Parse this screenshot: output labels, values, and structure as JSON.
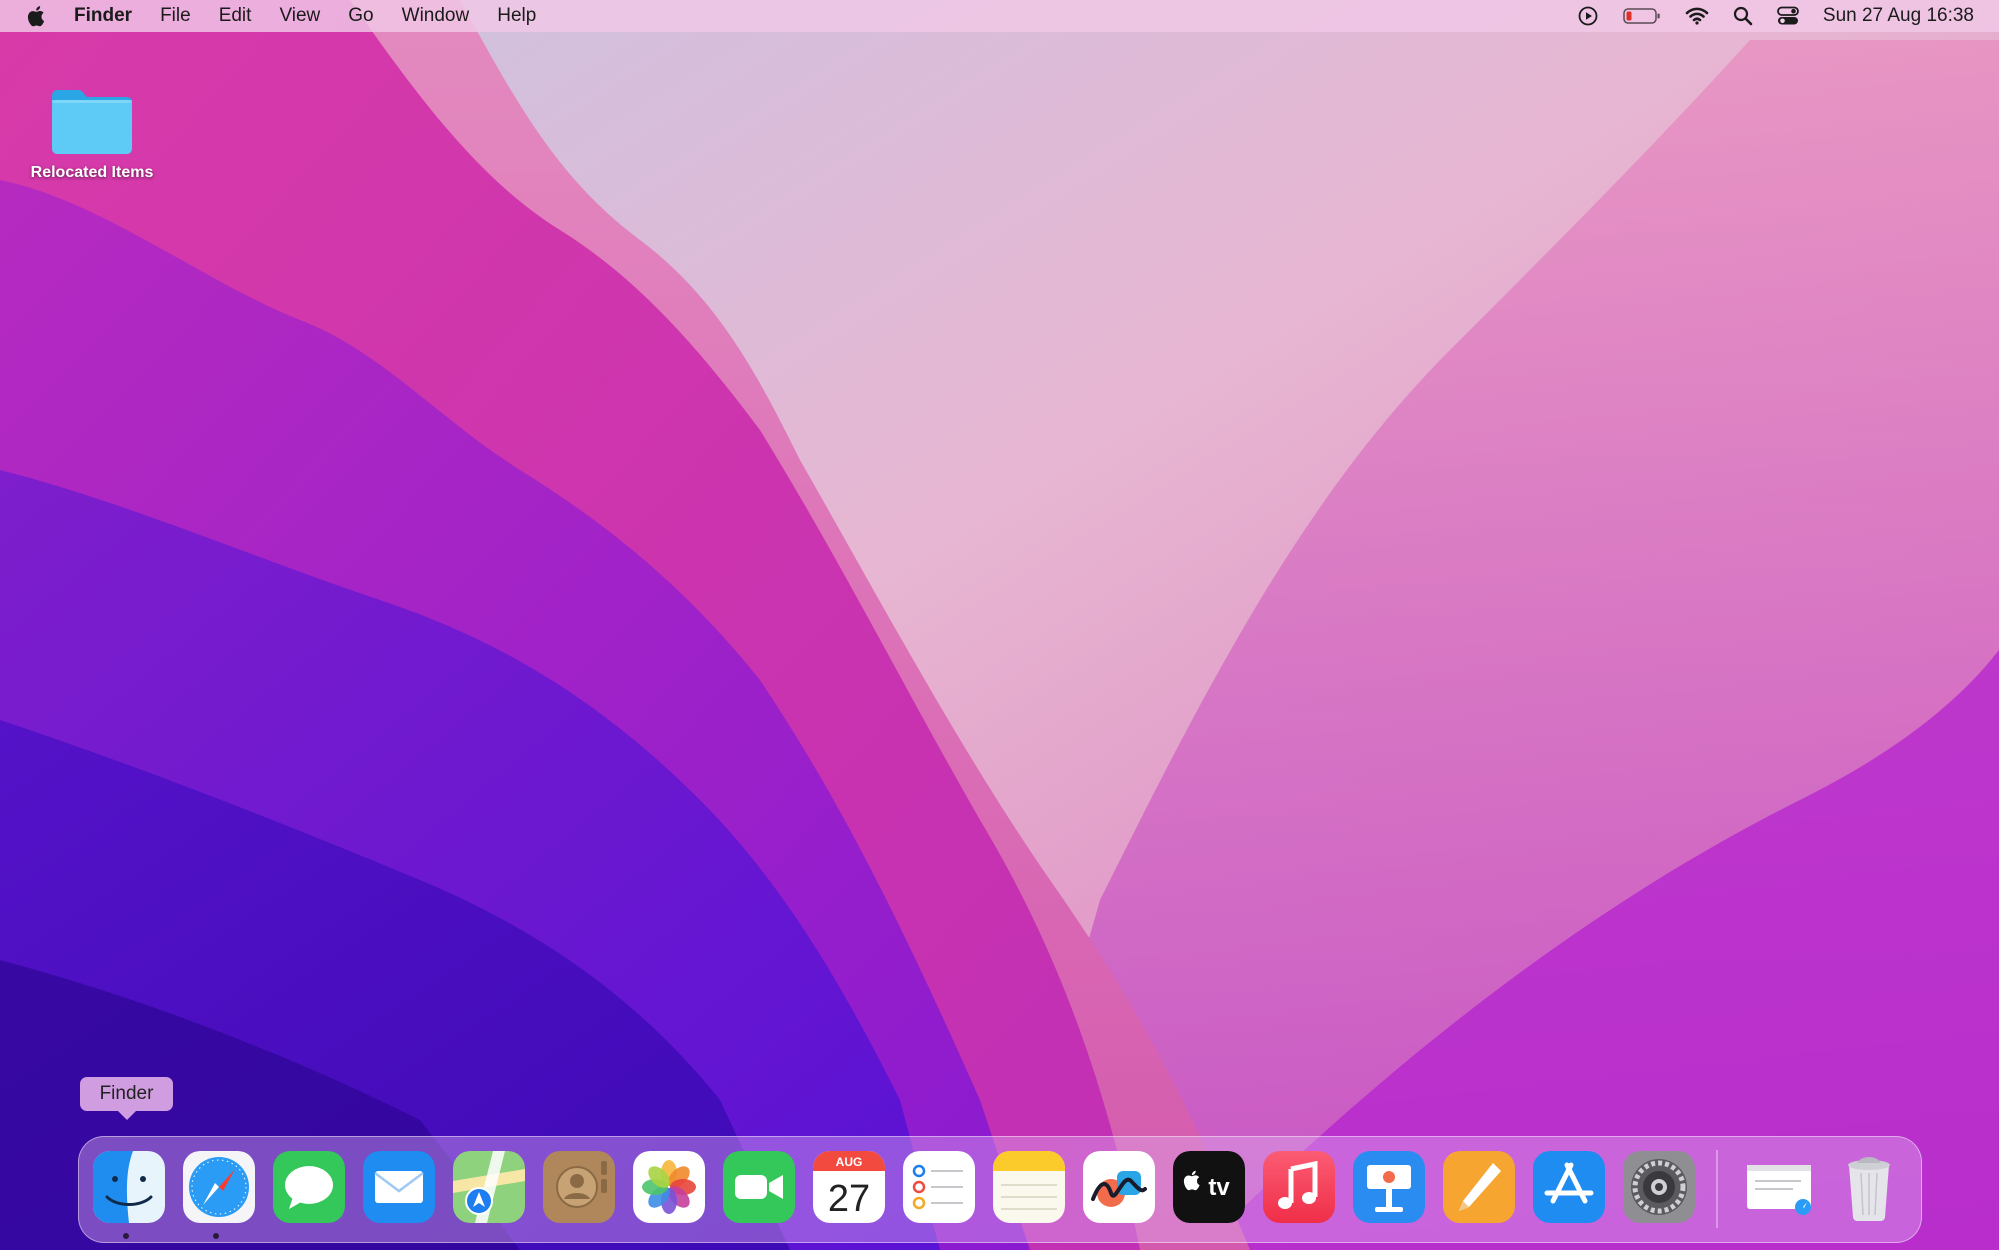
{
  "menubar": {
    "app_name": "Finder",
    "menus": [
      "File",
      "Edit",
      "View",
      "Go",
      "Window",
      "Help"
    ],
    "status_icons": [
      "play-circle-icon",
      "battery-icon",
      "wifi-icon",
      "search-icon",
      "control-center-icon"
    ],
    "clock": "Sun 27 Aug  16:38"
  },
  "desktop": {
    "icons": [
      {
        "label": "Relocated Items",
        "icon": "folder-icon"
      }
    ]
  },
  "tooltip": {
    "text": "Finder"
  },
  "dock": {
    "apps": [
      "Finder",
      "Safari",
      "Messages",
      "Mail",
      "Maps",
      "Contacts",
      "Photos",
      "FaceTime",
      "Calendar",
      "Reminders",
      "Notes",
      "Freeform",
      "TV",
      "Music",
      "Keynote",
      "Pages",
      "App Store",
      "System Settings"
    ],
    "running": [
      "Finder",
      "Safari"
    ],
    "calendar": {
      "month": "AUG",
      "day": "27"
    },
    "tv_label": "tv",
    "extras": [
      "Minimized window",
      "Trash"
    ]
  },
  "colors": {
    "accent": "#1e8cf0",
    "wallpaper_pink": "#d63aa8",
    "wallpaper_purple": "#5a10d0"
  }
}
